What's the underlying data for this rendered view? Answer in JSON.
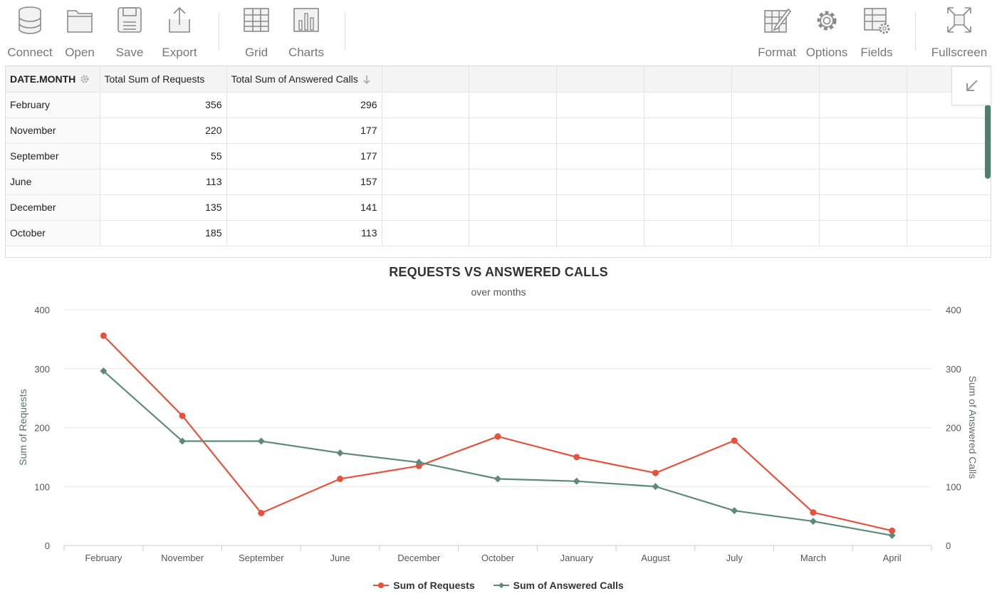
{
  "toolbar": {
    "left": [
      {
        "id": "connect",
        "label": "Connect",
        "icon": "database-icon"
      },
      {
        "id": "open",
        "label": "Open",
        "icon": "folder-icon"
      },
      {
        "id": "save",
        "label": "Save",
        "icon": "floppy-disk-icon"
      },
      {
        "id": "export",
        "label": "Export",
        "icon": "export-icon"
      },
      {
        "id": "grid",
        "label": "Grid",
        "icon": "grid-icon"
      },
      {
        "id": "charts",
        "label": "Charts",
        "icon": "bar-chart-icon"
      }
    ],
    "right": [
      {
        "id": "format",
        "label": "Format",
        "icon": "format-icon"
      },
      {
        "id": "options",
        "label": "Options",
        "icon": "gear-icon"
      },
      {
        "id": "fields",
        "label": "Fields",
        "icon": "fields-icon"
      },
      {
        "id": "fullscreen",
        "label": "Fullscreen",
        "icon": "fullscreen-icon"
      }
    ]
  },
  "grid": {
    "headers": [
      "DATE.MONTH",
      "Total Sum of Requests",
      "Total Sum of Answered Calls"
    ],
    "rows": [
      {
        "month": "February",
        "requests": "356",
        "answered": "296"
      },
      {
        "month": "November",
        "requests": "220",
        "answered": "177"
      },
      {
        "month": "September",
        "requests": "55",
        "answered": "177"
      },
      {
        "month": "June",
        "requests": "113",
        "answered": "157"
      },
      {
        "month": "December",
        "requests": "135",
        "answered": "141"
      },
      {
        "month": "October",
        "requests": "185",
        "answered": "113"
      }
    ]
  },
  "chart_data": {
    "type": "line",
    "title": "REQUESTS VS ANSWERED CALLS",
    "subtitle": "over months",
    "categories": [
      "February",
      "November",
      "September",
      "June",
      "December",
      "October",
      "January",
      "August",
      "July",
      "March",
      "April"
    ],
    "series": [
      {
        "name": "Sum of Requests",
        "color": "#e8513b",
        "marker": "circle",
        "axis": "left",
        "values": [
          356,
          220,
          55,
          113,
          135,
          185,
          150,
          123,
          178,
          56,
          25
        ]
      },
      {
        "name": "Sum of Answered Calls",
        "color": "#5f8a7a",
        "marker": "diamond",
        "axis": "right",
        "values": [
          296,
          177,
          177,
          157,
          141,
          113,
          109,
          100,
          59,
          41,
          17
        ]
      }
    ],
    "ylabel": "Sum of Requests",
    "ylabel_right": "Sum of Answered Calls",
    "ylim": [
      0,
      400
    ],
    "yticks": [
      0,
      100,
      200,
      300,
      400
    ],
    "grid": true,
    "legend": "bottom-center"
  }
}
